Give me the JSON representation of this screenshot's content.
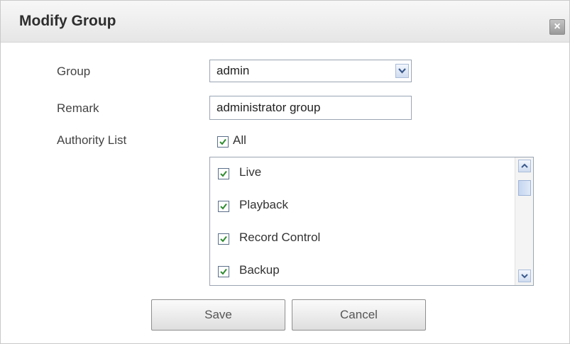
{
  "dialog": {
    "title": "Modify Group",
    "close_label": "×"
  },
  "form": {
    "group_label": "Group",
    "group_value": "admin",
    "remark_label": "Remark",
    "remark_value": "administrator group",
    "authority_label": "Authority List",
    "all_label": "All",
    "all_checked": true,
    "authorities": [
      {
        "label": "Live",
        "checked": true
      },
      {
        "label": "Playback",
        "checked": true
      },
      {
        "label": "Record Control",
        "checked": true
      },
      {
        "label": "Backup",
        "checked": true
      }
    ]
  },
  "buttons": {
    "save_label": "Save",
    "cancel_label": "Cancel"
  },
  "colors": {
    "check": "#2e8b2e",
    "border": "#9aa5b3"
  }
}
